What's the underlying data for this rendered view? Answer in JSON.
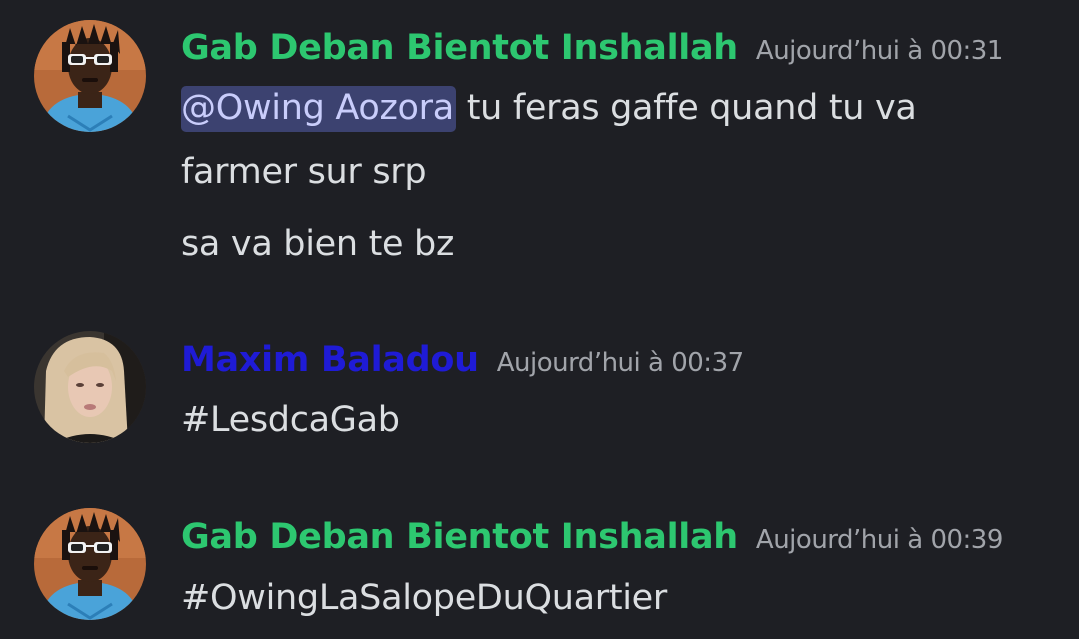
{
  "messages": [
    {
      "author": "Gab Deban Bientot Inshallah",
      "author_color": "#2dc770",
      "timestamp": "Aujourd’hui à 00:31",
      "avatar": "avatar-sunglasses",
      "mention": "@Owing Aozora",
      "lines": [
        " tu feras gaffe quand tu va",
        "farmer sur srp",
        "sa va bien te bz"
      ]
    },
    {
      "author": "Maxim Baladou",
      "author_color": "#1f1bd6",
      "timestamp": "Aujourd’hui à 00:37",
      "avatar": "avatar-blonde",
      "lines": [
        "#LesdcaGab"
      ]
    },
    {
      "author": "Gab Deban Bientot Inshallah",
      "author_color": "#2dc770",
      "timestamp": "Aujourd’hui à 00:39",
      "avatar": "avatar-sunglasses",
      "lines": [
        "#OwingLaSalopeDuQuartier"
      ]
    }
  ],
  "colors": {
    "background": "#1e1f24",
    "text": "#dbdee1",
    "timestamp": "#a1a4aa",
    "mention_bg": "#3c4270",
    "mention_text": "#c9cdfb"
  }
}
